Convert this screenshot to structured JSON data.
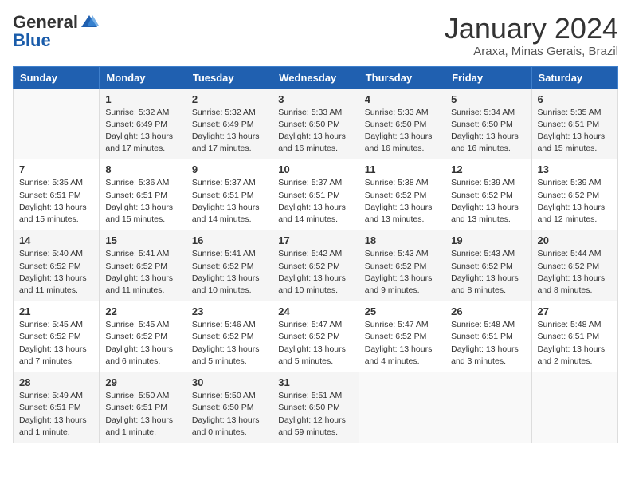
{
  "header": {
    "logo_general": "General",
    "logo_blue": "Blue",
    "title": "January 2024",
    "subtitle": "Araxa, Minas Gerais, Brazil"
  },
  "weekdays": [
    "Sunday",
    "Monday",
    "Tuesday",
    "Wednesday",
    "Thursday",
    "Friday",
    "Saturday"
  ],
  "weeks": [
    [
      {
        "day": "",
        "info": ""
      },
      {
        "day": "1",
        "info": "Sunrise: 5:32 AM\nSunset: 6:49 PM\nDaylight: 13 hours\nand 17 minutes."
      },
      {
        "day": "2",
        "info": "Sunrise: 5:32 AM\nSunset: 6:49 PM\nDaylight: 13 hours\nand 17 minutes."
      },
      {
        "day": "3",
        "info": "Sunrise: 5:33 AM\nSunset: 6:50 PM\nDaylight: 13 hours\nand 16 minutes."
      },
      {
        "day": "4",
        "info": "Sunrise: 5:33 AM\nSunset: 6:50 PM\nDaylight: 13 hours\nand 16 minutes."
      },
      {
        "day": "5",
        "info": "Sunrise: 5:34 AM\nSunset: 6:50 PM\nDaylight: 13 hours\nand 16 minutes."
      },
      {
        "day": "6",
        "info": "Sunrise: 5:35 AM\nSunset: 6:51 PM\nDaylight: 13 hours\nand 15 minutes."
      }
    ],
    [
      {
        "day": "7",
        "info": ""
      },
      {
        "day": "8",
        "info": "Sunrise: 5:36 AM\nSunset: 6:51 PM\nDaylight: 13 hours\nand 15 minutes."
      },
      {
        "day": "9",
        "info": "Sunrise: 5:37 AM\nSunset: 6:51 PM\nDaylight: 13 hours\nand 14 minutes."
      },
      {
        "day": "10",
        "info": "Sunrise: 5:37 AM\nSunset: 6:51 PM\nDaylight: 13 hours\nand 14 minutes."
      },
      {
        "day": "11",
        "info": "Sunrise: 5:38 AM\nSunset: 6:52 PM\nDaylight: 13 hours\nand 13 minutes."
      },
      {
        "day": "12",
        "info": "Sunrise: 5:39 AM\nSunset: 6:52 PM\nDaylight: 13 hours\nand 13 minutes."
      },
      {
        "day": "13",
        "info": "Sunrise: 5:39 AM\nSunset: 6:52 PM\nDaylight: 13 hours\nand 12 minutes."
      }
    ],
    [
      {
        "day": "14",
        "info": ""
      },
      {
        "day": "15",
        "info": "Sunrise: 5:41 AM\nSunset: 6:52 PM\nDaylight: 13 hours\nand 11 minutes."
      },
      {
        "day": "16",
        "info": "Sunrise: 5:41 AM\nSunset: 6:52 PM\nDaylight: 13 hours\nand 10 minutes."
      },
      {
        "day": "17",
        "info": "Sunrise: 5:42 AM\nSunset: 6:52 PM\nDaylight: 13 hours\nand 10 minutes."
      },
      {
        "day": "18",
        "info": "Sunrise: 5:43 AM\nSunset: 6:52 PM\nDaylight: 13 hours\nand 9 minutes."
      },
      {
        "day": "19",
        "info": "Sunrise: 5:43 AM\nSunset: 6:52 PM\nDaylight: 13 hours\nand 8 minutes."
      },
      {
        "day": "20",
        "info": "Sunrise: 5:44 AM\nSunset: 6:52 PM\nDaylight: 13 hours\nand 8 minutes."
      }
    ],
    [
      {
        "day": "21",
        "info": ""
      },
      {
        "day": "22",
        "info": "Sunrise: 5:45 AM\nSunset: 6:52 PM\nDaylight: 13 hours\nand 6 minutes."
      },
      {
        "day": "23",
        "info": "Sunrise: 5:46 AM\nSunset: 6:52 PM\nDaylight: 13 hours\nand 5 minutes."
      },
      {
        "day": "24",
        "info": "Sunrise: 5:47 AM\nSunset: 6:52 PM\nDaylight: 13 hours\nand 5 minutes."
      },
      {
        "day": "25",
        "info": "Sunrise: 5:47 AM\nSunset: 6:52 PM\nDaylight: 13 hours\nand 4 minutes."
      },
      {
        "day": "26",
        "info": "Sunrise: 5:48 AM\nSunset: 6:51 PM\nDaylight: 13 hours\nand 3 minutes."
      },
      {
        "day": "27",
        "info": "Sunrise: 5:48 AM\nSunset: 6:51 PM\nDaylight: 13 hours\nand 2 minutes."
      }
    ],
    [
      {
        "day": "28",
        "info": "Sunrise: 5:49 AM\nSunset: 6:51 PM\nDaylight: 13 hours\nand 1 minute."
      },
      {
        "day": "29",
        "info": "Sunrise: 5:50 AM\nSunset: 6:51 PM\nDaylight: 13 hours\nand 1 minute."
      },
      {
        "day": "30",
        "info": "Sunrise: 5:50 AM\nSunset: 6:50 PM\nDaylight: 13 hours\nand 0 minutes."
      },
      {
        "day": "31",
        "info": "Sunrise: 5:51 AM\nSunset: 6:50 PM\nDaylight: 12 hours\nand 59 minutes."
      },
      {
        "day": "",
        "info": ""
      },
      {
        "day": "",
        "info": ""
      },
      {
        "day": "",
        "info": ""
      }
    ]
  ],
  "week1_sun_info": "Sunrise: 5:35 AM\nSunset: 6:51 PM\nDaylight: 13 hours\nand 15 minutes.",
  "week2_sun_info": "Sunrise: 5:35 AM\nSunset: 6:51 PM\nDaylight: 13 hours\nand 15 minutes.",
  "week3_sun_info": "Sunrise: 5:40 AM\nSunset: 6:52 PM\nDaylight: 13 hours\nand 11 minutes.",
  "week4_sun_info": "Sunrise: 5:45 AM\nSunset: 6:52 PM\nDaylight: 13 hours\nand 7 minutes."
}
